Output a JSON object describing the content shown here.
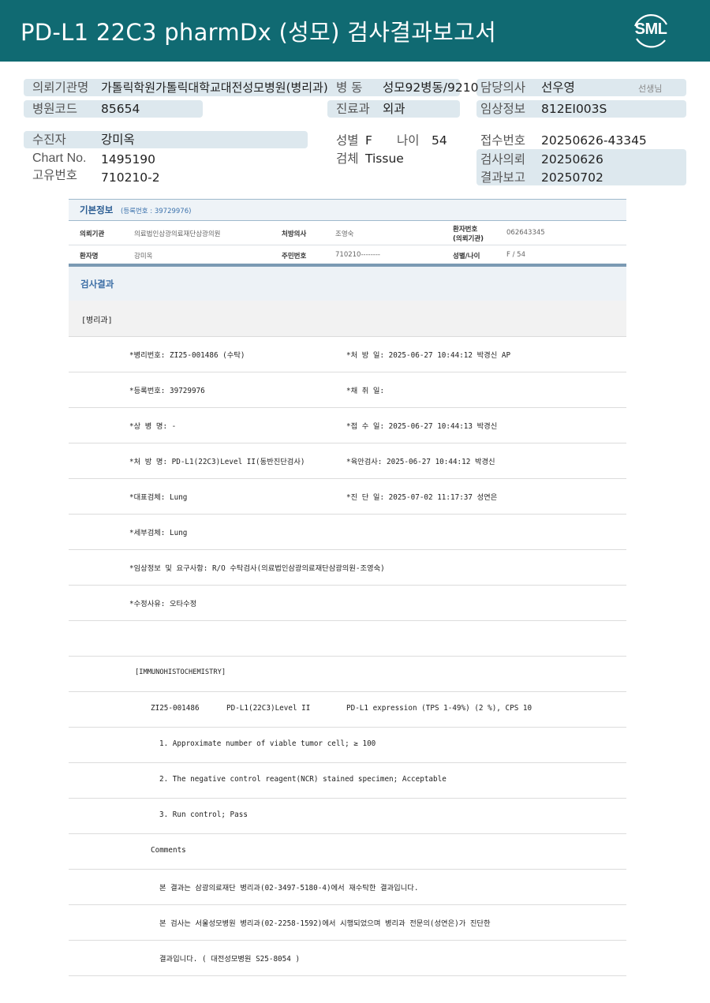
{
  "header": {
    "title": "PD-L1  22C3  pharmDx (성모) 검사결과보고서",
    "logo_text": "SML"
  },
  "info": {
    "institution": {
      "label": "의뢰기관명",
      "value": "가톨릭학원가톨릭대학교대전성모병원(병리과)"
    },
    "ward": {
      "label": "병    동",
      "value": "성모92병동/9210"
    },
    "doctor": {
      "label": "담당의사",
      "value": "선우영",
      "suffix": "선생님"
    },
    "hospital_code": {
      "label": "병원코드",
      "value": "85654"
    },
    "department": {
      "label": "진료과",
      "value": "외과"
    },
    "clinical_info": {
      "label": "임상정보",
      "value": "812EI003S"
    },
    "patient": {
      "label": "수진자",
      "value": "강미옥"
    },
    "sex": {
      "label": "성별",
      "value": "F"
    },
    "age": {
      "label": "나이",
      "value": "54"
    },
    "receipt_no": {
      "label": "접수번호",
      "value": "20250626-43345"
    },
    "chart_no": {
      "label": "Chart No.",
      "value": "1495190"
    },
    "specimen": {
      "label": "검체",
      "value": "Tissue"
    },
    "request_date": {
      "label": "검사의뢰",
      "value": "20250626"
    },
    "unique_no": {
      "label": "고유번호",
      "value": "710210-2"
    },
    "report_date": {
      "label": "결과보고",
      "value": "20250702"
    }
  },
  "basic": {
    "title": "기본정보",
    "reg": "(등록번호 : 39729976)",
    "inst_label": "의뢰기관",
    "inst_value": "의료법인삼광의료재단삼광의원",
    "presc_label": "처방의사",
    "presc_value": "조영숙",
    "pt_no_label1": "환자번호",
    "pt_no_label2": "(의뢰기관)",
    "pt_no_value": "062643345",
    "name_label": "환자명",
    "name_value": "강미옥",
    "rrn_label": "주민번호",
    "rrn_value": "710210--------",
    "sexage_label": "성별/나이",
    "sexage_value": "F / 54"
  },
  "results": {
    "title": "검사결과",
    "dept": "[병리과]",
    "l1a": "*병리번호: ZI25-001486 (수탁)",
    "l1b": "*처 방 일: 2025-06-27 10:44:12  박경신 AP",
    "l2a": "*등록번호: 39729976",
    "l2b": "*채 취 일:",
    "l3a": "*상 병 명: -",
    "l3b": "*접 수 일: 2025-06-27 10:44:13  박경신",
    "l4a": "*처 방 명: PD-L1(22C3)Level II(동반진단검사)",
    "l4b": "*육안검사: 2025-06-27 10:44:12  박경신",
    "l5a": "*대표검체: Lung",
    "l5b": "*진 단 일: 2025-07-02 11:17:37  성연은",
    "l6": "*세부검체: Lung",
    "l7": "*임상정보 및 요구사항: R/O 수탁검사(의료법인삼광의료재단삼광의원-조영숙)",
    "l8": "*수정사유: 오타수정",
    "ihc": "[IMMUNOHISTOCHEMISTRY]",
    "ihc_id": "ZI25-001486",
    "ihc_test": "PD-L1(22C3)Level II",
    "ihc_result": "PD-L1 expression (TPS 1-49%) (2 %), CPS 10",
    "item1": "1. Approximate number of viable tumor cell; ≥  100",
    "item2": "2. The negative control reagent(NCR) stained specimen; Acceptable",
    "item3": "3. Run control; Pass",
    "comments": "Comments",
    "c1": "본 결과는 삼광의료재단 병리과(02-3497-5180-4)에서 재수탁한 결과입니다.",
    "c2": "본 검사는 서울성모병원 병리과(02-2258-1592)에서 시행되었으며 병리과 전문의(성연은)가 진단한",
    "c3": "결과입니다. ( 대전성모병원 S25-8054 )"
  }
}
